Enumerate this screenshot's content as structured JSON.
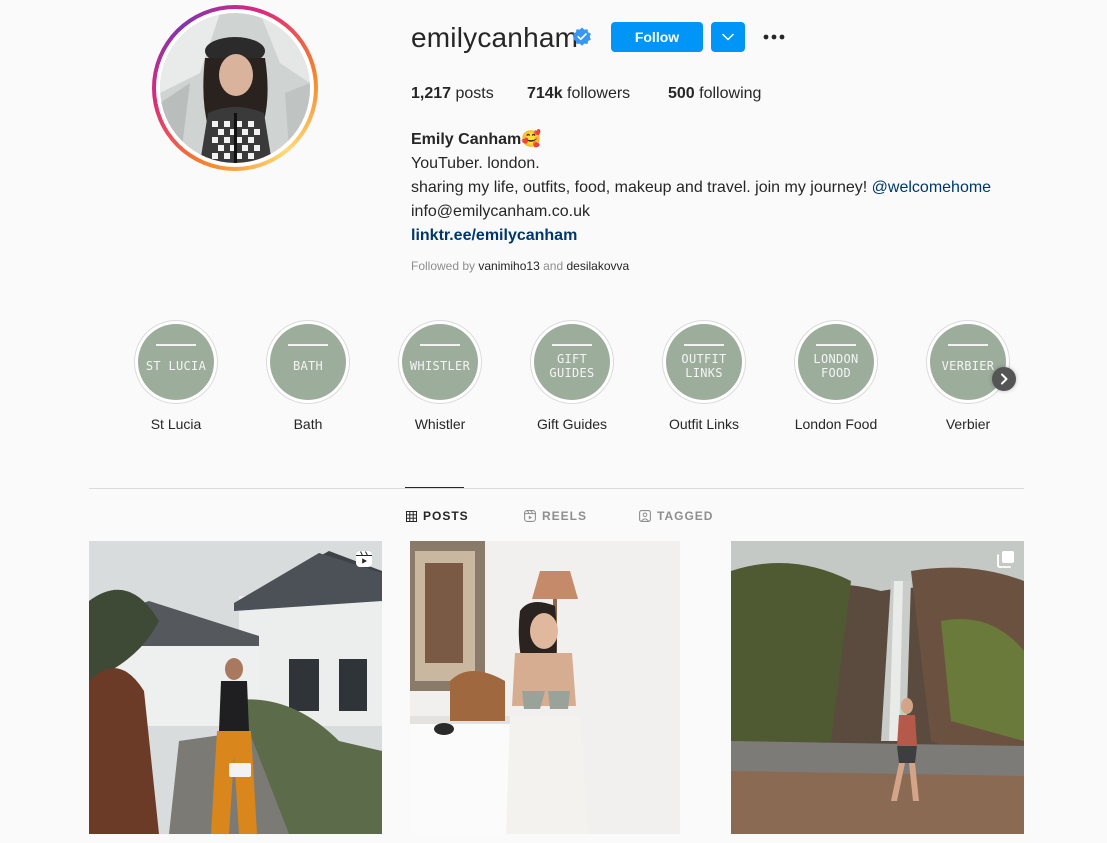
{
  "profile": {
    "username": "emilycanham",
    "follow_label": "Follow",
    "stats": {
      "posts_count": "1,217",
      "posts_label": "posts",
      "followers_count": "714k",
      "followers_label": "followers",
      "following_count": "500",
      "following_label": "following"
    },
    "bio": {
      "name": "Emily Canham🥰",
      "line1": "YouTuber. london.",
      "line2": "sharing my life, outfits, food, makeup and travel. join my journey! ",
      "mention": "@welcomehome",
      "email": "info@emilycanham.co.uk",
      "link": "linktr.ee/emilycanham"
    },
    "followed_by": {
      "prefix": "Followed by",
      "user1": "vanimiho13",
      "joiner": "and",
      "user2": "desilakovva"
    }
  },
  "highlights": [
    {
      "cover_line1": "ST LUCIA",
      "cover_line2": "",
      "label": "St Lucia"
    },
    {
      "cover_line1": "BATH",
      "cover_line2": "",
      "label": "Bath"
    },
    {
      "cover_line1": "WHISTLER",
      "cover_line2": "",
      "label": "Whistler"
    },
    {
      "cover_line1": "GIFT",
      "cover_line2": "GUIDES",
      "label": "Gift Guides"
    },
    {
      "cover_line1": "OUTFIT",
      "cover_line2": "LINKS",
      "label": "Outfit Links"
    },
    {
      "cover_line1": "LONDON",
      "cover_line2": "FOOD",
      "label": "London Food"
    },
    {
      "cover_line1": "VERBIER",
      "cover_line2": "",
      "label": "Verbier"
    }
  ],
  "tabs": [
    {
      "label": "POSTS",
      "icon": "grid-icon",
      "active": true
    },
    {
      "label": "REELS",
      "icon": "reels-icon",
      "active": false
    },
    {
      "label": "TAGGED",
      "icon": "tagged-icon",
      "active": false
    }
  ],
  "posts": [
    {
      "type": "reel",
      "badge_icon": "reel-icon"
    },
    {
      "type": "photo",
      "badge_icon": ""
    },
    {
      "type": "carousel",
      "badge_icon": "carousel-icon"
    }
  ],
  "colors": {
    "accent": "#0095f6",
    "highlight_cover": "#9cad9b",
    "link": "#00376b",
    "muted": "#8e8e8e"
  }
}
